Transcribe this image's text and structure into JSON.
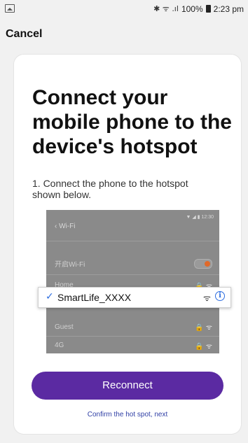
{
  "status_bar": {
    "icons": "✱ ᯤ .ıl",
    "battery": "100%",
    "time": "2:23 pm"
  },
  "header": {
    "cancel_label": "Cancel"
  },
  "card": {
    "title": "Connect your mobile phone to the device's hotspot",
    "step": "1. Connect the phone to the hotspot shown below.",
    "illustration": {
      "time": "12:30",
      "title": "Wi-Fi",
      "wifi_toggle_label": "开启Wi-Fi",
      "networks": [
        "Home",
        "Guest",
        "4G"
      ],
      "selected_ssid": "SmartLife_XXXX"
    },
    "reconnect_label": "Reconnect",
    "confirm_label": "Confirm the hot spot, next"
  },
  "colors": {
    "accent": "#5b2aa2",
    "link": "#2f3fa5",
    "check": "#2d6de0",
    "toggle": "#e0692a"
  }
}
